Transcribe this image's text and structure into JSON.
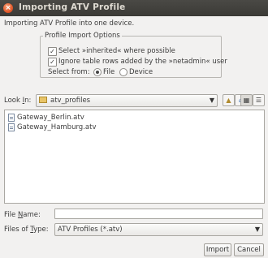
{
  "window": {
    "title": "Importing ATV Profile"
  },
  "intro_text": "Importing ATV Profile into one device.",
  "options": {
    "legend": "Profile Import Options",
    "select_inherited": {
      "label": "Select »inherited« where possible",
      "checked": true
    },
    "ignore_table_rows": {
      "label": "Ignore table rows added by the »netadmin« user",
      "checked": true
    },
    "select_from": {
      "label": "Select from:",
      "options": [
        {
          "label": "File",
          "selected": true
        },
        {
          "label": "Device",
          "selected": false
        }
      ]
    }
  },
  "look_in": {
    "label_prefix": "Look ",
    "label_mnemonic": "I",
    "label_suffix": "n:",
    "value": "atv_profiles"
  },
  "toolbar_icons": [
    "up-folder-icon",
    "home-icon",
    "new-folder-icon",
    "list-view-icon",
    "details-view-icon"
  ],
  "files": [
    {
      "name": "Gateway_Berlin.atv"
    },
    {
      "name": "Gateway_Hamburg.atv"
    }
  ],
  "file_name": {
    "label_prefix": "File ",
    "label_mnemonic": "N",
    "label_suffix": "ame:",
    "value": ""
  },
  "files_of_type": {
    "label_prefix": "Files of ",
    "label_mnemonic": "T",
    "label_suffix": "ype:",
    "value": "ATV Profiles (*.atv)"
  },
  "buttons": {
    "import": "Import",
    "cancel": "Cancel"
  }
}
